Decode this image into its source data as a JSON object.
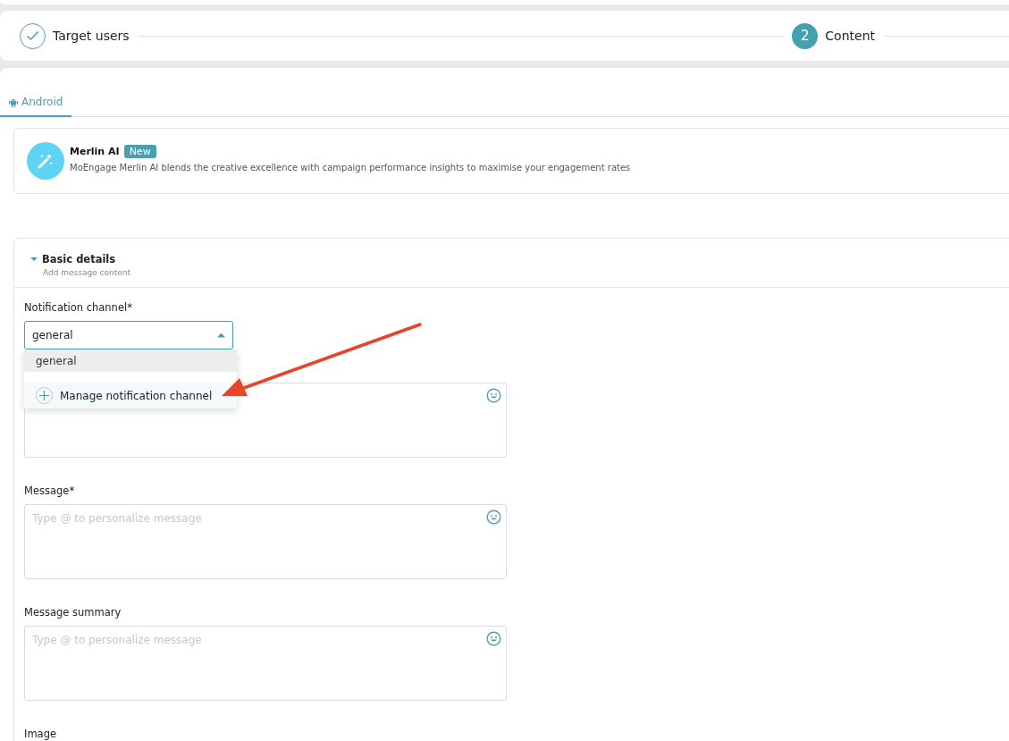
{
  "stepper": {
    "steps": [
      {
        "label": "Target users",
        "done": true
      },
      {
        "label": "Content",
        "number": "2",
        "done": false
      }
    ]
  },
  "tabs": [
    {
      "label": "Android",
      "selected": true
    }
  ],
  "merlin": {
    "title": "Merlin AI",
    "badge": "New",
    "description": "MoEngage Merlin AI blends the creative excellence with campaign performance insights to maximise your engagement rates"
  },
  "section": {
    "title": "Basic details",
    "subtitle": "Add message content",
    "expanded": true
  },
  "channel_select": {
    "label": "Notification channel*",
    "value": "general",
    "open": true,
    "options": [
      {
        "label": "general",
        "selected": true
      }
    ],
    "action": "Manage notification channel"
  },
  "fields": [
    {
      "kind": "textarea"
    },
    {
      "kind": "textarea",
      "label": "Message*",
      "placeholder": "Type @ to personalize message"
    },
    {
      "kind": "textarea",
      "label": "Message summary",
      "placeholder": "Type @ to personalize message"
    }
  ],
  "next_label": "Image"
}
